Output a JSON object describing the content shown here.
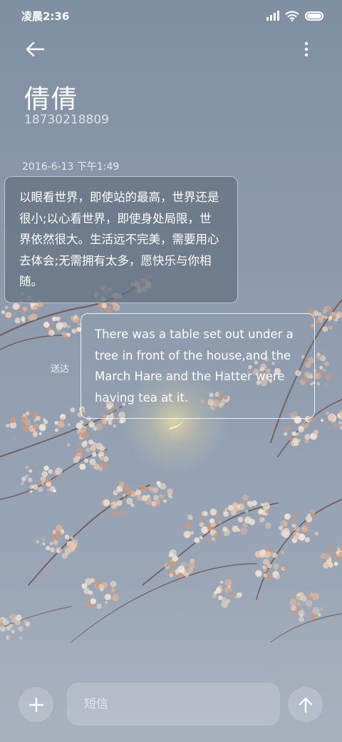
{
  "status_bar": {
    "time": "凌晨2:36",
    "icons": [
      "signal-icon",
      "wifi-icon",
      "battery-icon"
    ]
  },
  "header": {
    "back_icon": "back-arrow-icon",
    "more_icon": "more-vertical-icon",
    "contact_name": "倩倩",
    "contact_number": "18730218809"
  },
  "conversation": {
    "timestamp": "2016-6-13 下午1:49",
    "received_message": "以眼看世界，即使站的最高，世界还是很小;以心看世界，即使身处局限，世界依然很大。生活远不完美，需要用心去体会;无需拥有太多，愿快乐与你相随。",
    "sent_message": "There was a table set out under a tree in front of the house,and the March Hare and the Hatter were having tea at it.",
    "sent_status": "送达"
  },
  "compose": {
    "attach_icon": "plus-icon",
    "input_value": "",
    "input_placeholder": "短信",
    "send_icon": "arrow-up-icon"
  },
  "colors": {
    "background_top": "#7f8fa1",
    "background_bottom": "#a3adbb",
    "blossom": "#e9d3c2",
    "branch": "#6b4a3e",
    "moon_glow": "#f3e3a8",
    "received_bubble": "#627080"
  }
}
